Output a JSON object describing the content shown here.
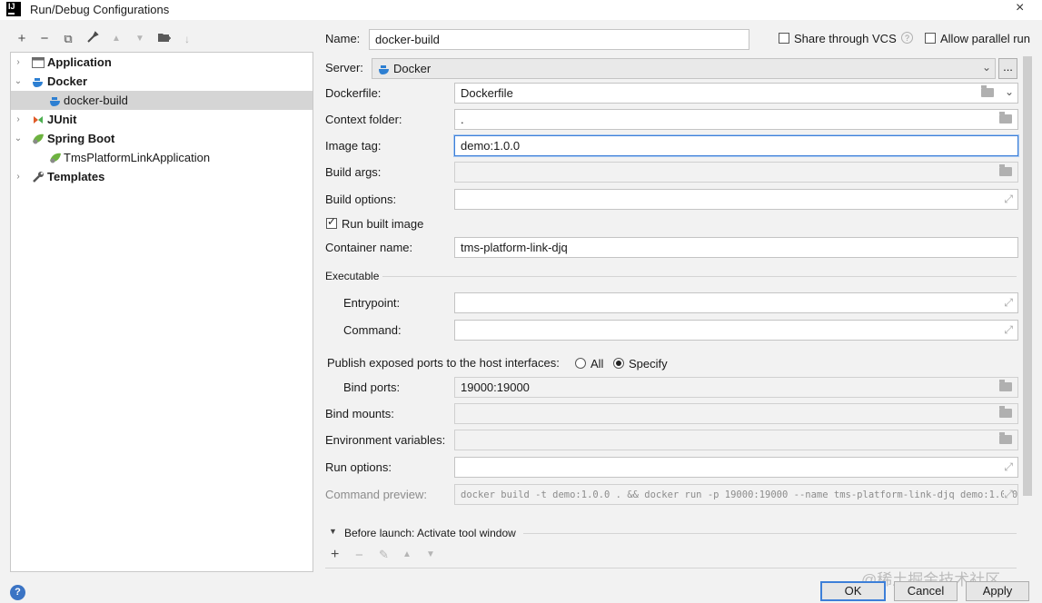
{
  "window": {
    "title": "Run/Debug Configurations",
    "close_icon": "×"
  },
  "toolbar": {
    "add": "+",
    "remove": "−",
    "copy": "⧉",
    "edit": "🔧",
    "move_up": "▲",
    "move_down": "▼",
    "folder": "▰",
    "sort": "↓"
  },
  "tree": {
    "items": [
      {
        "label": "Application",
        "icon": "application-icon",
        "bold": true
      },
      {
        "label": "Docker",
        "icon": "docker-icon",
        "bold": true
      },
      {
        "label": "docker-build",
        "icon": "docker-icon",
        "bold": false
      },
      {
        "label": "JUnit",
        "icon": "junit-icon",
        "bold": true
      },
      {
        "label": "Spring Boot",
        "icon": "spring-boot-icon",
        "bold": true
      },
      {
        "label": "TmsPlatformLinkApplication",
        "icon": "spring-boot-icon",
        "bold": false
      },
      {
        "label": "Templates",
        "icon": "wrench-icon",
        "bold": true
      }
    ]
  },
  "form": {
    "name_label": "Name:",
    "name_value": "docker-build",
    "share_vcs_label": "Share through VCS",
    "parallel_label": "Allow parallel run",
    "server_label": "Server:",
    "server_value": "Docker",
    "server_more": "...",
    "dockerfile_label": "Dockerfile:",
    "dockerfile_value": "Dockerfile",
    "context_label": "Context folder:",
    "context_value": ".",
    "image_tag_label": "Image tag:",
    "image_tag_value": "demo:1.0.0",
    "build_args_label": "Build args:",
    "build_options_label": "Build options:",
    "run_built_label": "Run built image",
    "container_label": "Container name:",
    "container_value": "tms-platform-link-djq",
    "executable_label": "Executable",
    "entrypoint_label": "Entrypoint:",
    "command_label": "Command:",
    "publish_label": "Publish exposed ports to the host interfaces:",
    "all_label": "All",
    "specify_label": "Specify",
    "bind_ports_label": "Bind ports:",
    "bind_ports_value": "19000:19000",
    "bind_mounts_label": "Bind mounts:",
    "env_label": "Environment variables:",
    "run_options_label": "Run options:",
    "preview_label": "Command preview:",
    "preview_value": "docker build -t demo:1.0.0 . && docker run -p 19000:19000 --name tms-platform-link-djq demo:1.0.0",
    "before_launch_label": "Before launch: Activate tool window"
  },
  "buttons": {
    "ok": "OK",
    "cancel": "Cancel",
    "apply": "Apply",
    "help": "?"
  },
  "watermark": "@稀土掘金技术社区",
  "colors": {
    "selection": "#d5d5d5",
    "focus": "#3d7fd8",
    "accent_blue": "#3b74c4"
  }
}
